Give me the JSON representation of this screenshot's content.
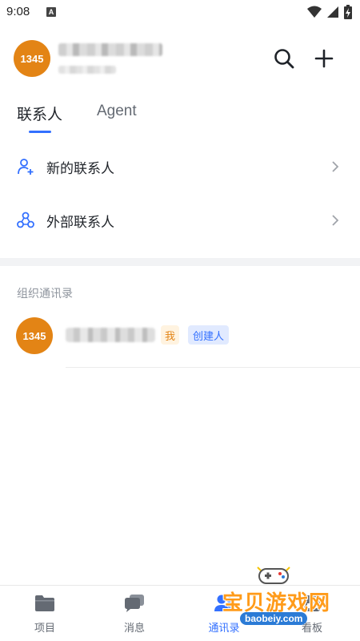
{
  "status_bar": {
    "time": "9:08",
    "notification_glyph": "A"
  },
  "header": {
    "avatar_text": "1345"
  },
  "tabs": [
    {
      "label": "联系人",
      "active": true
    },
    {
      "label": "Agent",
      "active": false
    }
  ],
  "contact_actions": [
    {
      "label": "新的联系人",
      "icon": "add-user-icon"
    },
    {
      "label": "外部联系人",
      "icon": "external-contacts-icon"
    }
  ],
  "org_directory": {
    "title": "组织通讯录",
    "member": {
      "avatar_text": "1345",
      "tag_me": "我",
      "tag_creator": "创建人"
    }
  },
  "bottom_nav": [
    {
      "label": "项目",
      "icon": "folder-icon",
      "active": false
    },
    {
      "label": "消息",
      "icon": "chat-icon",
      "active": false
    },
    {
      "label": "通讯录",
      "icon": "contacts-icon",
      "active": true
    },
    {
      "label": "看板",
      "icon": "board-icon",
      "active": false
    }
  ],
  "watermark": {
    "text": "宝贝游戏网",
    "url": "baobeiy.com"
  },
  "colors": {
    "accent": "#3370ff",
    "avatar": "#e38415",
    "section_bg": "#f2f3f5"
  }
}
